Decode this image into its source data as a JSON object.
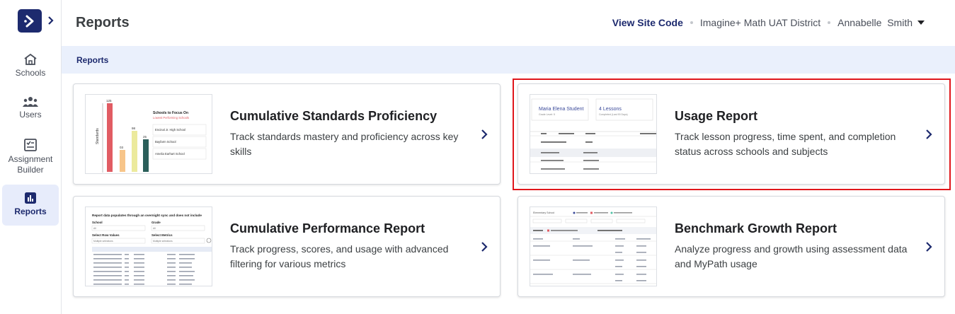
{
  "header": {
    "title": "Reports",
    "site_code_label": "View Site Code",
    "district": "Imagine+ Math UAT District",
    "user_first": "Annabelle",
    "user_last": "Smith"
  },
  "breadcrumb": "Reports",
  "sidebar": {
    "items": [
      {
        "label": "Schools",
        "icon": "home-icon"
      },
      {
        "label": "Users",
        "icon": "users-icon"
      },
      {
        "label": "Assignment Builder",
        "icon": "assignment-icon"
      },
      {
        "label": "Reports",
        "icon": "reports-icon",
        "active": true
      }
    ]
  },
  "cards": [
    {
      "title": "Cumulative Standards Proficiency",
      "description": "Track standards mastery and proficiency across key skills"
    },
    {
      "title": "Usage Report",
      "description": "Track lesson progress, time spent, and completion status across schools and subjects",
      "highlighted": true
    },
    {
      "title": "Cumulative Performance Report",
      "description": "Track progress, scores, and usage with advanced filtering for various metrics"
    },
    {
      "title": "Benchmark Growth Report",
      "description": "Analyze progress and growth using assessment data and MyPath usage"
    }
  ],
  "thumbs": {
    "standards": {
      "ylabel": "Standards",
      "values": [
        "125",
        "03",
        "98",
        "25"
      ],
      "heading": "Schools to Focus On",
      "sub": "Lowest Performing Schools",
      "schools": [
        "Encinal Jr. High School",
        "Bayfarm School",
        "Amelia Earhart School"
      ]
    },
    "usage": {
      "student": "Maria Elena Student",
      "student_sub": "Grade Level: 5",
      "lessons": "4 Lessons",
      "lessons_sub": "Completed (Last 90 Days)"
    },
    "performance": {
      "notice": "Report data populates through an overnight sync and does not include",
      "school_label": "School",
      "grade_label": "Grade",
      "all": "All",
      "row_values_label": "Select Row Values",
      "metrics_label": "Select Metrics",
      "multi": "Multiple selections"
    },
    "benchmark": {
      "label": "Elementary School"
    }
  },
  "colors": {
    "brand": "#1d2a6e",
    "highlight": "#e0161b",
    "crumb_bg": "#eaf0fc"
  }
}
